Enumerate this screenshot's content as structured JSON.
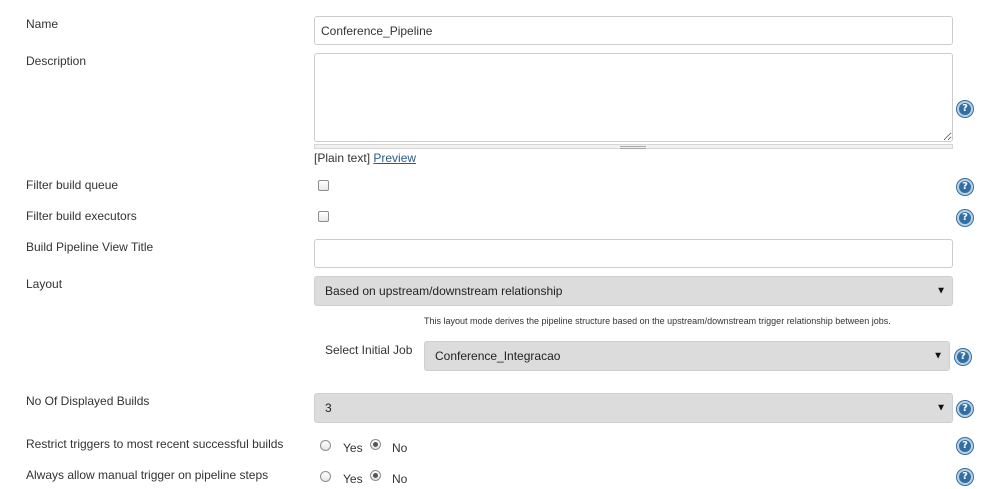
{
  "name": {
    "label": "Name",
    "value": "Conference_Pipeline"
  },
  "description": {
    "label": "Description",
    "value": "",
    "format_prefix": "[Plain text]",
    "preview_link": "Preview"
  },
  "filter_build_queue": {
    "label": "Filter build queue",
    "checked": false
  },
  "filter_build_executors": {
    "label": "Filter build executors",
    "checked": false
  },
  "view_title": {
    "label": "Build Pipeline View Title",
    "value": ""
  },
  "layout": {
    "label": "Layout",
    "selected": "Based on upstream/downstream relationship",
    "hint": "This layout mode derives the pipeline structure based on the upstream/downstream trigger relationship between jobs.",
    "initial_job_label": "Select Initial Job",
    "initial_job_selected": "Conference_Integracao"
  },
  "displayed_builds": {
    "label": "No Of Displayed Builds",
    "selected": "3"
  },
  "restrict_triggers": {
    "label": "Restrict triggers to most recent successful builds",
    "yes": "Yes",
    "no": "No",
    "selected": "No"
  },
  "manual_trigger": {
    "label": "Always allow manual trigger on pipeline steps",
    "yes": "Yes",
    "no": "No",
    "selected": "No"
  },
  "icons": {
    "help": "help-icon",
    "dropdown": "triangle-down-icon"
  },
  "help_glyph": "?",
  "arrow_glyph": "▼",
  "colors": {
    "help": "#2f6fa4",
    "link": "#2a5a8a",
    "select_bg": "#dcdcdc"
  }
}
